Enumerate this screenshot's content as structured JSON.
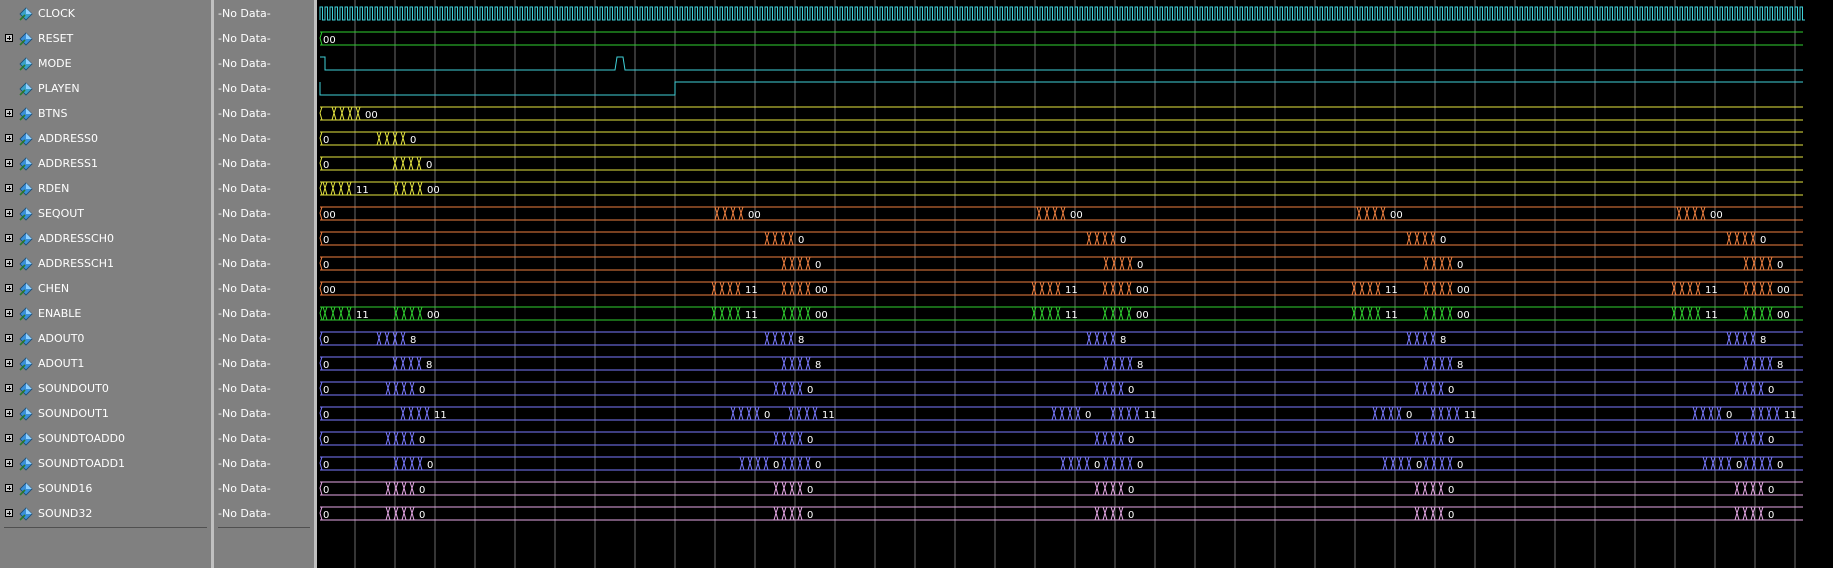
{
  "value_placeholder": "-No Data-",
  "signals": [
    {
      "name": "CLOCK",
      "bus": false,
      "color": "#3fd0d8",
      "kind": "clock"
    },
    {
      "name": "RESET",
      "bus": true,
      "color": "#30d030",
      "kind": "bus",
      "labels": [
        [
          0,
          "00"
        ]
      ]
    },
    {
      "name": "MODE",
      "bus": false,
      "color": "#3fd0d8",
      "kind": "bit"
    },
    {
      "name": "PLAYEN",
      "bus": false,
      "color": "#3fd0d8",
      "kind": "bit"
    },
    {
      "name": "BTNS",
      "bus": true,
      "color": "#e6e640",
      "kind": "bus",
      "labels": [
        [
          42,
          "00"
        ]
      ]
    },
    {
      "name": "ADDRESS0",
      "bus": true,
      "color": "#e6e640",
      "kind": "bus",
      "labels": [
        [
          0,
          "0"
        ],
        [
          87,
          "0"
        ]
      ]
    },
    {
      "name": "ADDRESS1",
      "bus": true,
      "color": "#e6e640",
      "kind": "bus",
      "labels": [
        [
          0,
          "0"
        ],
        [
          103,
          "0"
        ]
      ]
    },
    {
      "name": "RDEN",
      "bus": true,
      "color": "#e6e640",
      "kind": "bus",
      "labels": [
        [
          33,
          "11"
        ],
        [
          104,
          "00"
        ]
      ]
    },
    {
      "name": "SEQOUT",
      "bus": true,
      "color": "#f08040",
      "kind": "bus",
      "labels": [
        [
          0,
          "00"
        ],
        [
          425,
          "00"
        ],
        [
          747,
          "00"
        ],
        [
          1067,
          "00"
        ],
        [
          1387,
          "00"
        ]
      ]
    },
    {
      "name": "ADDRESSCH0",
      "bus": true,
      "color": "#f08040",
      "kind": "bus",
      "labels": [
        [
          0,
          "0"
        ],
        [
          475,
          "0"
        ],
        [
          797,
          "0"
        ],
        [
          1117,
          "0"
        ],
        [
          1437,
          "0"
        ]
      ]
    },
    {
      "name": "ADDRESSCH1",
      "bus": true,
      "color": "#f08040",
      "kind": "bus",
      "labels": [
        [
          0,
          "0"
        ],
        [
          492,
          "0"
        ],
        [
          814,
          "0"
        ],
        [
          1134,
          "0"
        ],
        [
          1454,
          "0"
        ]
      ]
    },
    {
      "name": "CHEN",
      "bus": true,
      "color": "#f08040",
      "kind": "bus",
      "labels": [
        [
          0,
          "00"
        ],
        [
          422,
          "11"
        ],
        [
          492,
          "00"
        ],
        [
          742,
          "11"
        ],
        [
          813,
          "00"
        ],
        [
          1062,
          "11"
        ],
        [
          1134,
          "00"
        ],
        [
          1382,
          "11"
        ],
        [
          1454,
          "00"
        ]
      ]
    },
    {
      "name": "ENABLE",
      "bus": true,
      "color": "#30d030",
      "kind": "bus",
      "labels": [
        [
          33,
          "11"
        ],
        [
          104,
          "00"
        ],
        [
          422,
          "11"
        ],
        [
          492,
          "00"
        ],
        [
          742,
          "11"
        ],
        [
          813,
          "00"
        ],
        [
          1062,
          "11"
        ],
        [
          1134,
          "00"
        ],
        [
          1382,
          "11"
        ],
        [
          1454,
          "00"
        ]
      ]
    },
    {
      "name": "ADOUT0",
      "bus": true,
      "color": "#7a7aff",
      "kind": "bus",
      "labels": [
        [
          0,
          "0"
        ],
        [
          87,
          "8"
        ],
        [
          475,
          "8"
        ],
        [
          797,
          "8"
        ],
        [
          1117,
          "8"
        ],
        [
          1437,
          "8"
        ]
      ]
    },
    {
      "name": "ADOUT1",
      "bus": true,
      "color": "#7a7aff",
      "kind": "bus",
      "labels": [
        [
          0,
          "0"
        ],
        [
          103,
          "8"
        ],
        [
          492,
          "8"
        ],
        [
          814,
          "8"
        ],
        [
          1134,
          "8"
        ],
        [
          1454,
          "8"
        ]
      ]
    },
    {
      "name": "SOUNDOUT0",
      "bus": true,
      "color": "#7a7aff",
      "kind": "bus",
      "labels": [
        [
          0,
          "0"
        ],
        [
          96,
          "0"
        ],
        [
          484,
          "0"
        ],
        [
          805,
          "0"
        ],
        [
          1125,
          "0"
        ],
        [
          1445,
          "0"
        ]
      ]
    },
    {
      "name": "SOUNDOUT1",
      "bus": true,
      "color": "#7a7aff",
      "kind": "bus",
      "labels": [
        [
          0,
          "0"
        ],
        [
          111,
          "11"
        ],
        [
          441,
          "0"
        ],
        [
          499,
          "11"
        ],
        [
          762,
          "0"
        ],
        [
          821,
          "11"
        ],
        [
          1083,
          "0"
        ],
        [
          1141,
          "11"
        ],
        [
          1403,
          "0"
        ],
        [
          1461,
          "11"
        ]
      ]
    },
    {
      "name": "SOUNDTOADD0",
      "bus": true,
      "color": "#7a7aff",
      "kind": "bus",
      "labels": [
        [
          0,
          "0"
        ],
        [
          96,
          "0"
        ],
        [
          484,
          "0"
        ],
        [
          805,
          "0"
        ],
        [
          1125,
          "0"
        ],
        [
          1445,
          "0"
        ]
      ]
    },
    {
      "name": "SOUNDTOADD1",
      "bus": true,
      "color": "#7a7aff",
      "kind": "bus",
      "labels": [
        [
          0,
          "0"
        ],
        [
          104,
          "0"
        ],
        [
          450,
          "0"
        ],
        [
          492,
          "0"
        ],
        [
          771,
          "0"
        ],
        [
          814,
          "0"
        ],
        [
          1093,
          "0"
        ],
        [
          1134,
          "0"
        ],
        [
          1413,
          "0"
        ],
        [
          1454,
          "0"
        ]
      ]
    },
    {
      "name": "SOUND16",
      "bus": true,
      "color": "#e6a8e6",
      "kind": "bus",
      "labels": [
        [
          0,
          "0"
        ],
        [
          96,
          "0"
        ],
        [
          484,
          "0"
        ],
        [
          805,
          "0"
        ],
        [
          1125,
          "0"
        ],
        [
          1445,
          "0"
        ]
      ]
    },
    {
      "name": "SOUND32",
      "bus": true,
      "color": "#e6a8e6",
      "kind": "bus",
      "labels": [
        [
          0,
          "0"
        ],
        [
          96,
          "0"
        ],
        [
          484,
          "0"
        ],
        [
          805,
          "0"
        ],
        [
          1125,
          "0"
        ],
        [
          1445,
          "0"
        ]
      ]
    }
  ]
}
